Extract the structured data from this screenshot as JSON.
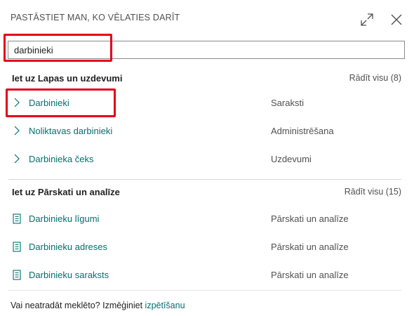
{
  "dialog": {
    "title": "PASTĀSTIET MAN, KO VĒLATIES DARĪT",
    "expand_icon": "expand-icon",
    "close_icon": "close-icon"
  },
  "search": {
    "value": "darbinieki",
    "placeholder": ""
  },
  "sections": [
    {
      "title": "Iet uz Lapas un uzdevumi",
      "show_all": "Rādīt visu (8)",
      "items": [
        {
          "name": "Darbinieki",
          "category": "Saraksti",
          "icon": "chevron-right-icon"
        },
        {
          "name": "Noliktavas darbinieki",
          "category": "Administrēšana",
          "icon": "chevron-right-icon"
        },
        {
          "name": "Darbinieka čeks",
          "category": "Uzdevumi",
          "icon": "chevron-right-icon"
        }
      ]
    },
    {
      "title": "Iet uz Pārskati un analīze",
      "show_all": "Rādīt visu (15)",
      "items": [
        {
          "name": "Darbinieku līgumi",
          "category": "Pārskati un analīze",
          "icon": "report-icon"
        },
        {
          "name": "Darbinieku adreses",
          "category": "Pārskati un analīze",
          "icon": "report-icon"
        },
        {
          "name": "Darbinieku saraksts",
          "category": "Pārskati un analīze",
          "icon": "report-icon"
        }
      ]
    }
  ],
  "footer": {
    "text": "Vai neatradāt meklēto? Izmēģiniet ",
    "link": "izpētīšanu"
  },
  "colors": {
    "accent": "#00706d",
    "highlight": "#e3001b"
  }
}
